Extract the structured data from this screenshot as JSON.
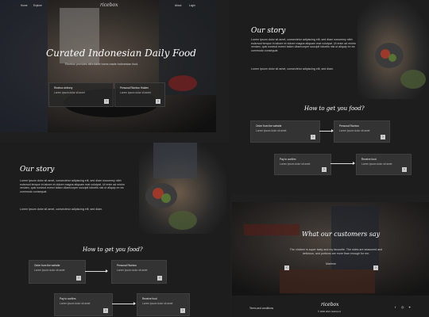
{
  "colors": {
    "bg": "#1f1f1f",
    "card": "#333333",
    "text": "#dddddd"
  },
  "brand": "ricebox",
  "hero": {
    "nav": [
      "Home",
      "Explore",
      "About",
      "Login"
    ],
    "title": "Curated Indonesian Daily Food",
    "subtitle": "Ricebox provides affordable home-made Indonesian food.",
    "cards": [
      {
        "title": "Ricebox delivery",
        "text": "Lorem Ipsum dolor sit amet"
      },
      {
        "title": "Personal Ricebox Hidden",
        "text": "Lorem Ipsum dolor sit amet"
      }
    ]
  },
  "story": {
    "title": "Our story",
    "para1": "Lorem ipsum dolor sit amet, consectetur adipiscing elit, sed diam nonummy nibh euismod tempor in labore et dolore magna aliquam erat volutpat. Ut enim ad minim veniam, quis nostrud exerci tation ullamcorper suscipit lobortis nisl ut aliquip ex ea commodo consequat.",
    "para2": "Lorem ipsum dolor sit amet, consectetur adipiscing elit, sed diam."
  },
  "how": {
    "title": "How to get you food?",
    "steps": [
      {
        "title": "Order from the website",
        "text": "Lorem ipsum dolor sit amet"
      },
      {
        "title": "Personal Ricebox",
        "text": "Lorem ipsum dolor sit amet"
      },
      {
        "title": "Pay to confirm",
        "text": "Lorem ipsum dolor sit amet"
      },
      {
        "title": "Receive food",
        "text": "Lorem ipsum dolor sit amet"
      }
    ]
  },
  "testimonial": {
    "title": "What our customers say",
    "quote": "The chicken is super tasty and my favourite. The sides are seasoned and delicious, and portions are more than enough for me.",
    "name": "Marlene"
  },
  "footer": {
    "left": "Terms and conditions",
    "brand": "ricebox",
    "copy": "© 2020 2021 ricebox.id"
  }
}
